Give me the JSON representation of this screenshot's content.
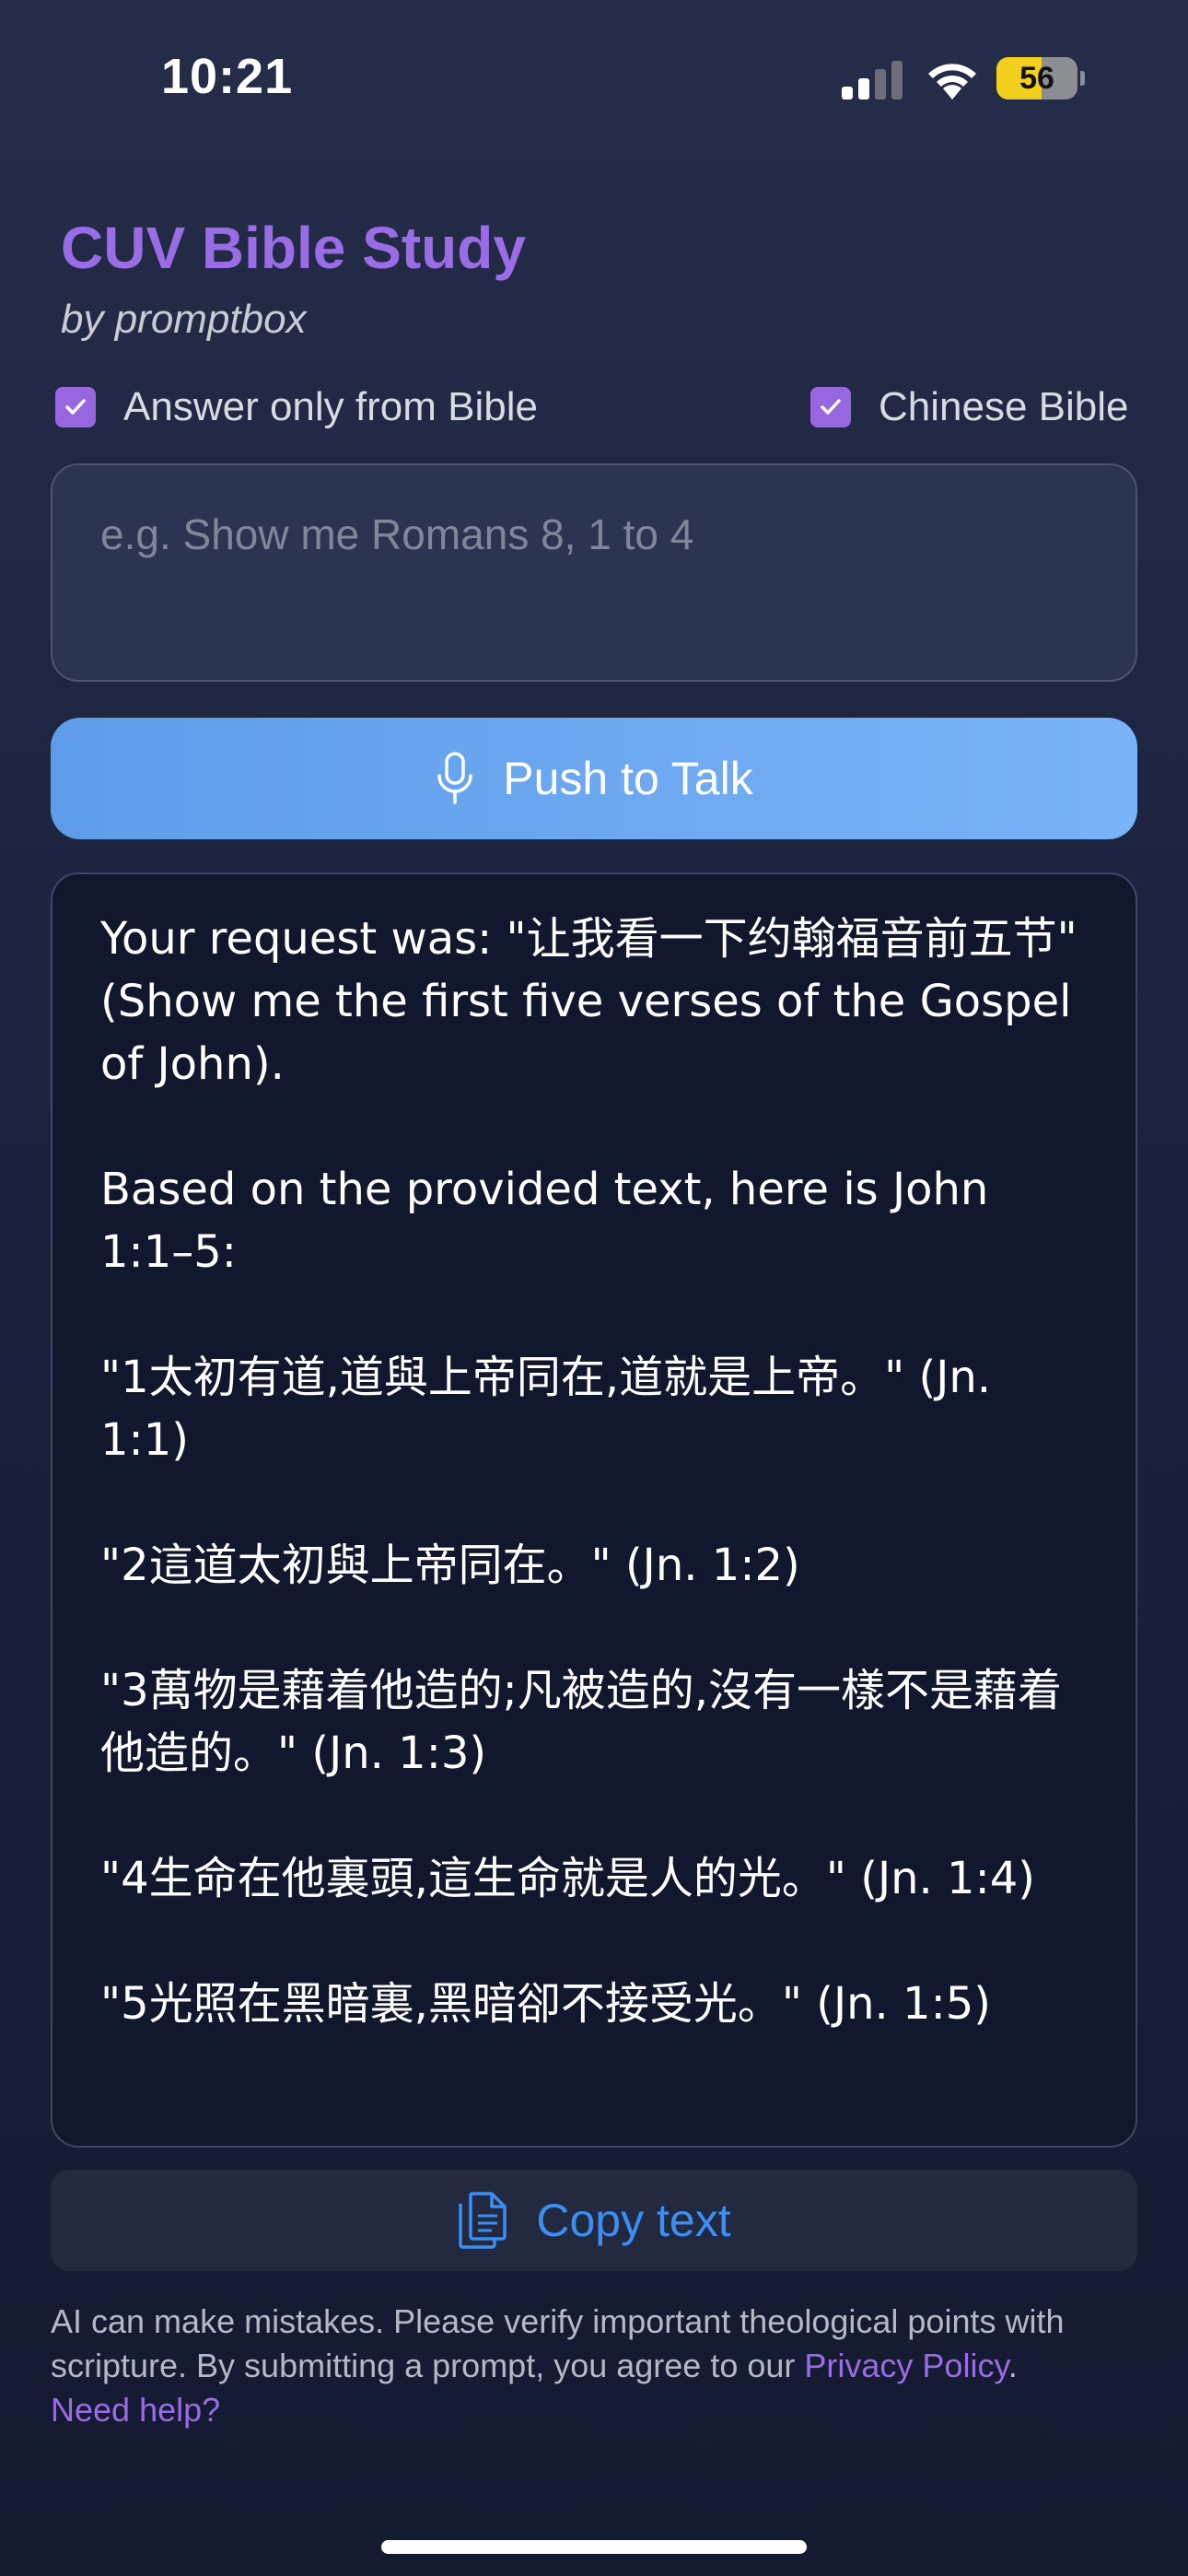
{
  "status_bar": {
    "time": "10:21",
    "battery_percent": "56",
    "battery_level": 0.56,
    "icons": [
      "signal-icon",
      "wifi-icon",
      "battery-icon"
    ]
  },
  "header": {
    "title": "CUV Bible Study",
    "subtitle": "by promptbox"
  },
  "options": {
    "answer_only_label": "Answer only from Bible",
    "answer_only_checked": true,
    "chinese_bible_label": "Chinese Bible",
    "chinese_bible_checked": true
  },
  "prompt": {
    "placeholder": "e.g. Show me Romans 8, 1 to 4",
    "value": ""
  },
  "talk_button": {
    "label": "Push to Talk",
    "icon": "microphone-icon"
  },
  "response": {
    "paragraphs": [
      "Your request was: \"让我看一下约翰福音前五节\" (Show me the first five verses of the Gospel of John).",
      "Based on the provided text, here is John 1:1–5:",
      "\"1太初有道,道與上帝同在,道就是上帝。\" (Jn. 1:1)",
      "\"2這道太初與上帝同在。\" (Jn. 1:2)",
      "\"3萬物是藉着他造的;凡被造的,沒有一樣不是藉着他造的。\" (Jn. 1:3)",
      "\"4生命在他裏頭,這生命就是人的光。\" (Jn. 1:4)",
      "\"5光照在黑暗裏,黑暗卻不接受光。\" (Jn. 1:5)"
    ]
  },
  "copy_button": {
    "label": "Copy text",
    "icon": "copy-icon"
  },
  "footer": {
    "disclaimer_text": "AI can make mistakes. Please verify important theological points with scripture. By submitting a prompt, you agree to our ",
    "privacy_link": "Privacy Policy",
    "period": ".",
    "help_link": "Need help?"
  },
  "colors": {
    "accent_purple": "#9a6ce6",
    "talk_blue": "#6aa7f1",
    "copy_blue": "#3a8ef6",
    "battery_yellow": "#f3cf1e"
  }
}
